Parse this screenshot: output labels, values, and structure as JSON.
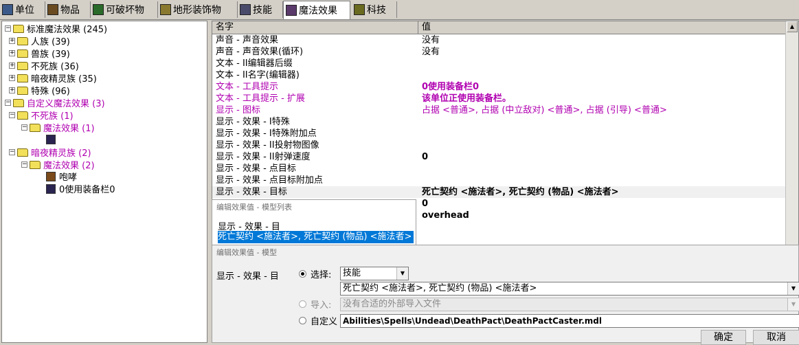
{
  "tabs": [
    {
      "label": "单位",
      "icon": "unit-icon",
      "color": "#3b5a8a"
    },
    {
      "label": "物品",
      "icon": "item-icon",
      "color": "#6a4a20"
    },
    {
      "label": "可破坏物",
      "icon": "destructible-icon",
      "color": "#2a6a2a"
    },
    {
      "label": "地形装饰物",
      "icon": "doodad-icon",
      "color": "#8a7a30"
    },
    {
      "label": "技能",
      "icon": "ability-icon",
      "color": "#4a4a6a"
    },
    {
      "label": "魔法效果",
      "icon": "buff-icon",
      "color": "#5a3a6a"
    },
    {
      "label": "科技",
      "icon": "upgrade-icon",
      "color": "#6a6a20"
    }
  ],
  "tree": {
    "root_standard": "标准魔法效果 (245)",
    "human": "人族 (39)",
    "orc": "兽族 (39)",
    "undead": "不死族 (36)",
    "nightelf": "暗夜精灵族 (35)",
    "special": "特殊 (96)",
    "root_custom": "自定义魔法效果 (3)",
    "custom_undead": "不死族 (1)",
    "custom_undead_buffs": "魔法效果 (1)",
    "custom_nightelf": "暗夜精灵族 (2)",
    "custom_nightelf_buffs": "魔法效果 (2)",
    "item_roar": "咆哮",
    "item_slot": "0使用装备栏0"
  },
  "list": {
    "col_name": "名字",
    "col_value": "值",
    "rows": [
      {
        "name": "声音 - 声音效果",
        "value": "没有"
      },
      {
        "name": "声音 - 声音效果(循环)",
        "value": "没有"
      },
      {
        "name": "文本 - II编辑器后缀",
        "value": ""
      },
      {
        "name": "文本 - II名字(编辑器)",
        "value": ""
      },
      {
        "name": "文本 - 工具提示",
        "value": "0使用装备栏0"
      },
      {
        "name": "文本 - 工具提示 - 扩展",
        "value": "该单位正使用装备栏。"
      },
      {
        "name": "显示 - 图标",
        "value": "占据 <普通>, 占据 (中立敌对) <普通>, 占据 (引导) <普通>"
      },
      {
        "name": "显示 - 效果 - I特殊",
        "value": ""
      },
      {
        "name": "显示 - 效果 - I特殊附加点",
        "value": ""
      },
      {
        "name": "显示 - 效果 - II投射物图像",
        "value": ""
      },
      {
        "name": "显示 - 效果 - II射弹速度",
        "value": "0"
      },
      {
        "name": "显示 - 效果 - 点目标",
        "value": ""
      },
      {
        "name": "显示 - 效果 - 点目标附加点",
        "value": ""
      },
      {
        "name": "显示 - 效果 - 目标",
        "value": "死亡契约 <施法者>, 死亡契约 (物品) <施法者>"
      },
      {
        "name": "",
        "value": "0"
      },
      {
        "name": "",
        "value": "overhead"
      }
    ]
  },
  "dialog_list": {
    "title": "编辑效果值 - 模型列表",
    "label": "显示 - 效果 - 目",
    "selected_item": "死亡契约 <施法者>, 死亡契约 (物品) <施法者>"
  },
  "dialog_model": {
    "title": "编辑效果值 - 模型",
    "label": "显示 - 效果 - 目",
    "opt_select": "选择:",
    "select_value": "技能",
    "model_value": "死亡契约 <施法者>, 死亡契约 (物品) <施法者>",
    "opt_import": "导入:",
    "import_value": "没有合适的外部导入文件",
    "opt_custom": "自定义",
    "custom_value": "Abilities\\Spells\\Undead\\DeathPact\\DeathPactCaster.mdl",
    "ok_label": "确定",
    "cancel_label": "取消"
  },
  "colors": {
    "highlight": "#b000b0",
    "selection": "#0078d7"
  }
}
